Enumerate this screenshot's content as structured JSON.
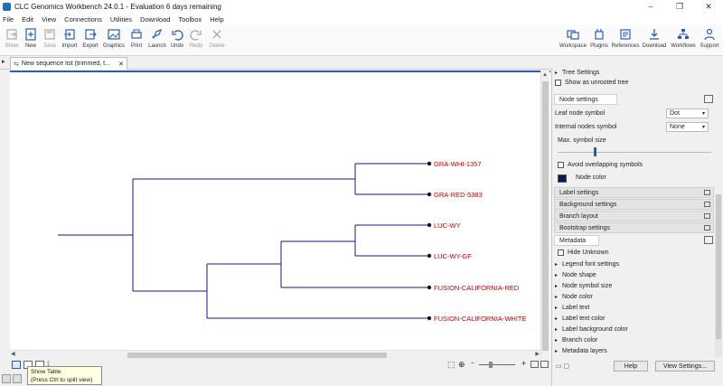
{
  "window": {
    "title": "CLC Genomics Workbench 24.0.1 - Evaluation 6 days remaining",
    "controls": [
      "–",
      "❐",
      "✕"
    ]
  },
  "menu": [
    "File",
    "Edit",
    "View",
    "Connections",
    "Utilities",
    "Download",
    "Toolbox",
    "Help"
  ],
  "toolbar": {
    "left": [
      {
        "label": "Show",
        "icon": "show-icon",
        "disabled": true
      },
      {
        "label": "New",
        "icon": "new-icon",
        "disabled": false
      },
      {
        "label": "Save",
        "icon": "save-icon",
        "disabled": true
      },
      {
        "label": "Import",
        "icon": "import-icon",
        "disabled": false
      },
      {
        "label": "Export",
        "icon": "export-icon",
        "disabled": false
      },
      {
        "label": "Graphics",
        "icon": "graphics-icon",
        "disabled": false
      },
      {
        "label": "Print",
        "icon": "print-icon",
        "disabled": false
      },
      {
        "label": "Launch",
        "icon": "launch-icon",
        "disabled": false
      },
      {
        "label": "Undo",
        "icon": "undo-icon",
        "disabled": false
      },
      {
        "label": "Redo",
        "icon": "redo-icon",
        "disabled": true
      },
      {
        "label": "Delete",
        "icon": "delete-icon",
        "disabled": true
      }
    ],
    "right": [
      {
        "label": "Workspace",
        "icon": "workspace-icon"
      },
      {
        "label": "Plugins",
        "icon": "plugins-icon"
      },
      {
        "label": "References",
        "icon": "references-icon"
      },
      {
        "label": "Download",
        "icon": "download-icon"
      },
      {
        "label": "Workflows",
        "icon": "workflows-icon"
      },
      {
        "label": "Support",
        "icon": "support-icon"
      }
    ]
  },
  "tab": {
    "label": "New sequence list (trimmed, t...",
    "close": "✕"
  },
  "tree": {
    "leaves": [
      "GRA-WHI-1357",
      "GRA-RED-5383",
      "LUC-WY",
      "LUC-WY-GF",
      "FUSION-CALIFORNIA-RED",
      "FUSION-CALIFORNIA-WHITE"
    ],
    "leaf_colors": [
      "#c00000",
      "#c00000",
      "#c00000",
      "#c00000",
      "#c00000",
      "#c00000"
    ],
    "branch_color": "#1a1a7a"
  },
  "tooltip": {
    "line1": "Show Table",
    "line2": "(Press Ctrl to split view)"
  },
  "right_panel": {
    "tree_settings": "Tree Settings",
    "show_unrooted": "Show as unrooted tree",
    "node_settings": "Node settings",
    "leaf_node_symbol_label": "Leaf node symbol",
    "leaf_node_symbol_value": "Dot",
    "internal_nodes_label": "Internal nodes symbol",
    "internal_nodes_value": "None",
    "max_symbol_size": "Max. symbol size",
    "avoid_overlapping": "Avoid overlapping symbols",
    "node_color": "Node color",
    "node_color_value": "#0a1a4d",
    "sections": [
      "Label settings",
      "Background settings",
      "Branch layout",
      "Bootstrap settings"
    ],
    "metadata": "Metadata",
    "hide_unknown": "Hide Unknown",
    "metadata_items": [
      "Legend font settings",
      "Node shape",
      "Node symbol size",
      "Node color",
      "Label text",
      "Label text color",
      "Label background color",
      "Branch color",
      "Metadata layers"
    ],
    "help_button": "Help",
    "view_settings_button": "View Settings..."
  }
}
